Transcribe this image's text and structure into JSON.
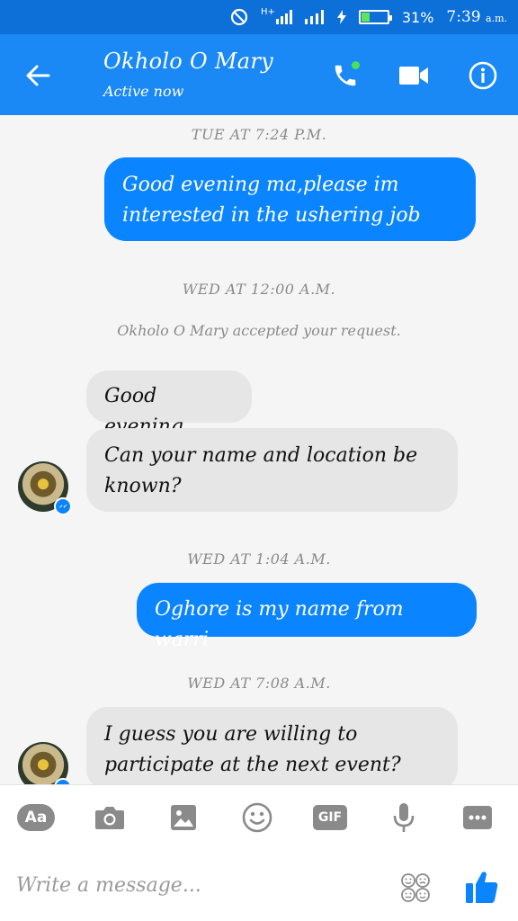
{
  "status_bar": {
    "signal_label": "H+",
    "battery_percent": "31%",
    "battery_level": 0.31,
    "time": "7:39",
    "time_suffix": "a.m."
  },
  "header": {
    "contact_name": "Okholo O Mary",
    "contact_status": "Active now",
    "icons": [
      "back-arrow-icon",
      "phone-icon",
      "video-camera-icon",
      "info-icon"
    ]
  },
  "chat": {
    "ts1": "TUE AT 7:24 P.M.",
    "msg1": "Good evening ma,please im interested in the ushering job",
    "ts2": "WED AT 12:00 A.M.",
    "notice": "Okholo O Mary accepted your request.",
    "msg2": "Good evening",
    "msg3": "Can your name and location be known?",
    "ts3": "WED AT 1:04 A.M.",
    "msg4": "Oghore is my name from warri",
    "ts4": "WED AT 7:08 A.M.",
    "msg5": "I guess you are willing to participate at the next event?"
  },
  "composer": {
    "aa_label": "Aa",
    "gif_label": "GIF",
    "placeholder": "Write a message...",
    "tools": [
      "text-style",
      "camera-icon",
      "image-icon",
      "emoji-icon",
      "gif-icon",
      "microphone-icon",
      "more-icon"
    ]
  },
  "colors": {
    "status_bar": "#0d6fd8",
    "app_bar": "#1a88f5",
    "outgoing_bubble": "#0a84ff",
    "incoming_bubble": "#e6e6e6"
  }
}
